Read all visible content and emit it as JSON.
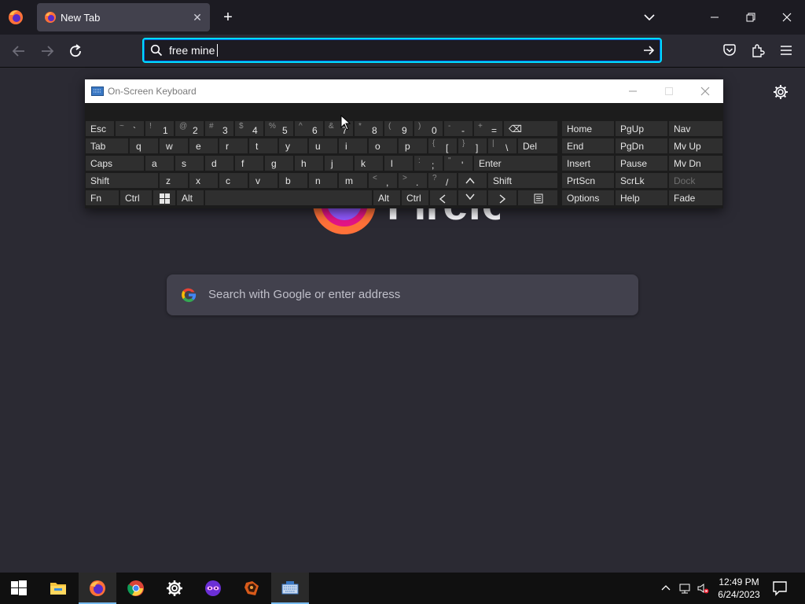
{
  "browser": {
    "tab": {
      "title": "New Tab",
      "close_glyph": "✕"
    },
    "new_tab_glyph": "+",
    "urlbar": {
      "value": "free mine"
    },
    "icons": [
      "firefox-icon",
      "back-arrow-icon",
      "forward-arrow-icon",
      "reload-icon",
      "search-icon",
      "go-arrow-icon",
      "pocket-icon",
      "extensions-icon",
      "hamburger-menu-icon",
      "list-tabs-chevron-icon",
      "minimize-icon",
      "restore-icon",
      "close-icon"
    ]
  },
  "newtab": {
    "logo_text": "Firefox",
    "search_placeholder": "Search with Google or enter address"
  },
  "osk": {
    "title": "On-Screen Keyboard",
    "rows": {
      "r1": {
        "esc": "Esc",
        "tilde": {
          "s": "~",
          "m": "`"
        },
        "k1": {
          "s": "!",
          "m": "1"
        },
        "k2": {
          "s": "@",
          "m": "2"
        },
        "k3": {
          "s": "#",
          "m": "3"
        },
        "k4": {
          "s": "$",
          "m": "4"
        },
        "k5": {
          "s": "%",
          "m": "5"
        },
        "k6": {
          "s": "^",
          "m": "6"
        },
        "k7": {
          "s": "&",
          "m": "7"
        },
        "k8": {
          "s": "*",
          "m": "8"
        },
        "k9": {
          "s": "(",
          "m": "9"
        },
        "k0": {
          "s": ")",
          "m": "0"
        },
        "minus": {
          "s": "-",
          "m": "-"
        },
        "equal": {
          "s": "+",
          "m": "="
        },
        "backspace": "⌫"
      },
      "r2": {
        "tab": "Tab",
        "letters": [
          "q",
          "w",
          "e",
          "r",
          "t",
          "y",
          "u",
          "i",
          "o",
          "p"
        ],
        "lbracket": {
          "s": "{",
          "m": "["
        },
        "rbracket": {
          "s": "}",
          "m": "]"
        },
        "backslash": {
          "s": "|",
          "m": "\\"
        },
        "del": "Del"
      },
      "r3": {
        "caps": "Caps",
        "letters": [
          "a",
          "s",
          "d",
          "f",
          "g",
          "h",
          "j",
          "k",
          "l"
        ],
        "semicolon": {
          "s": ":",
          "m": ";"
        },
        "quote": {
          "s": "\"",
          "m": "'"
        },
        "enter": "Enter"
      },
      "r4": {
        "shift_l": "Shift",
        "letters": [
          "z",
          "x",
          "c",
          "v",
          "b",
          "n",
          "m"
        ],
        "comma": {
          "s": "<",
          "m": ","
        },
        "period": {
          "s": ">",
          "m": "."
        },
        "slash": {
          "s": "?",
          "m": "/"
        },
        "up": "^",
        "shift_r": "Shift"
      },
      "r5": {
        "fn": "Fn",
        "ctrl_l": "Ctrl",
        "alt_l": "Alt",
        "alt_r": "Alt",
        "ctrl_r": "Ctrl",
        "left": "<",
        "down": "v",
        "right": ">"
      }
    },
    "nav": {
      "home": "Home",
      "pgup": "PgUp",
      "navkey": "Nav",
      "end": "End",
      "pgdn": "PgDn",
      "mvup": "Mv Up",
      "insert": "Insert",
      "pause": "Pause",
      "mvdn": "Mv Dn",
      "prtscn": "PrtScn",
      "scrlk": "ScrLk",
      "dock": "Dock",
      "options": "Options",
      "help": "Help",
      "fade": "Fade"
    }
  },
  "taskbar": {
    "apps": [
      "start-icon",
      "file-explorer-icon",
      "firefox-icon",
      "chrome-icon",
      "settings-icon",
      "mask-app-icon",
      "game-app-icon",
      "osk-app-icon"
    ],
    "clock": {
      "time": "12:49 PM",
      "date": "6/24/2023"
    }
  },
  "colors": {
    "accent": "#00ddff",
    "tab_bg": "#42414d",
    "page_bg": "#2b2a33"
  }
}
